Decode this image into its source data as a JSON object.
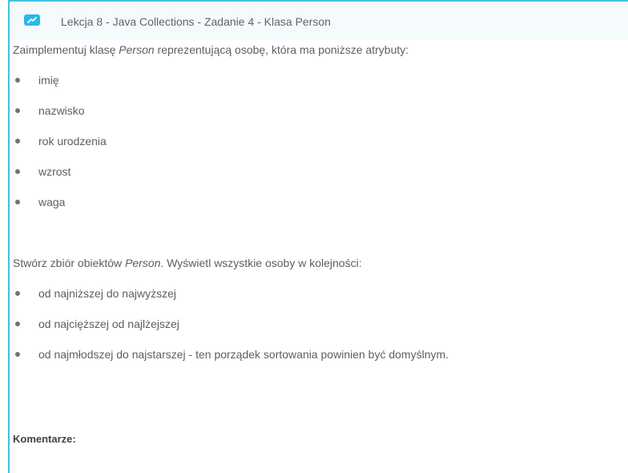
{
  "header": {
    "icon": "edit-icon",
    "title": "Lekcja 8 - Java Collections - Zadanie 4 - Klasa Person"
  },
  "intro": {
    "before": "Zaimplementuj klasę ",
    "emphasis": "Person",
    "after": " reprezentującą osobę, która ma poniższe atrybuty:"
  },
  "attributes": [
    "imię",
    "nazwisko",
    "rok urodzenia",
    "wzrost",
    "waga"
  ],
  "task": {
    "before": "Stwórz zbiór obiektów ",
    "emphasis": "Person",
    "after": ". Wyświetl wszystkie osoby w kolejności:"
  },
  "orderings": [
    "od najniższej do najwyższej",
    "od najcięższej od najlżejszej",
    "od najmłodszej do najstarszej - ten porządek sortowania powinien być domyślnym."
  ],
  "comments_label": "Komentarze:",
  "colors": {
    "accent": "#3ec3e0",
    "icon": "#2cb7e4"
  }
}
